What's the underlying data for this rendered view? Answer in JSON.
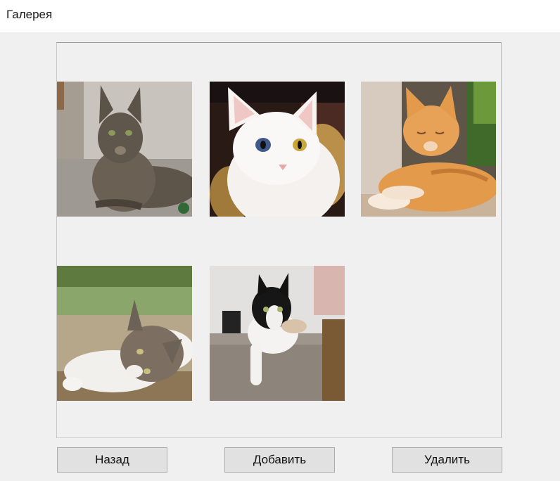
{
  "window": {
    "title": "Галерея"
  },
  "gallery": {
    "images": [
      {
        "subject": "tabby cat lying on carpet"
      },
      {
        "subject": "white odd-eyed cat"
      },
      {
        "subject": "orange cat with closed eyes"
      },
      {
        "subject": "white and tabby cat lying on ground"
      },
      {
        "subject": "black and white cat on sofa arm"
      }
    ]
  },
  "buttons": {
    "back": "Назад",
    "add": "Добавить",
    "delete": "Удалить"
  }
}
